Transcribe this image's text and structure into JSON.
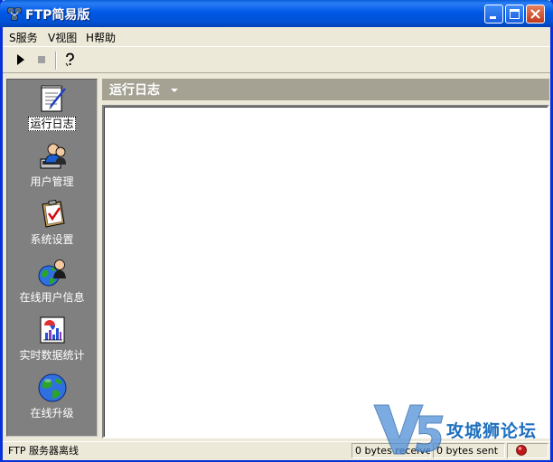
{
  "window": {
    "title": "FTP简易版"
  },
  "menu": [
    {
      "label": "S服务"
    },
    {
      "label": "V视图"
    },
    {
      "label": "H帮助"
    }
  ],
  "toolbar": {
    "start_icon": "play-icon",
    "stop_icon": "stop-icon",
    "help_icon": "help-icon"
  },
  "sidebar": {
    "items": [
      {
        "label": "运行日志",
        "icon": "log-notepad-icon",
        "selected": true
      },
      {
        "label": "用户管理",
        "icon": "user-management-icon",
        "selected": false
      },
      {
        "label": "系统设置",
        "icon": "clipboard-settings-icon",
        "selected": false
      },
      {
        "label": "在线用户信息",
        "icon": "online-user-globe-icon",
        "selected": false
      },
      {
        "label": "实时数据统计",
        "icon": "statistics-chart-icon",
        "selected": false
      },
      {
        "label": "在线升级",
        "icon": "globe-upgrade-icon",
        "selected": false
      }
    ]
  },
  "main": {
    "header_title": "运行日志"
  },
  "status": {
    "server_state": "FTP 服务器离线",
    "received": "0 bytes received",
    "sent": "0 bytes sent"
  },
  "watermark": {
    "text": "攻城狮论坛"
  },
  "colors": {
    "titlebar": "#0058e6",
    "sidebar_bg": "#808080",
    "header_bg": "#a5a294",
    "window_bg": "#ece9d8"
  }
}
